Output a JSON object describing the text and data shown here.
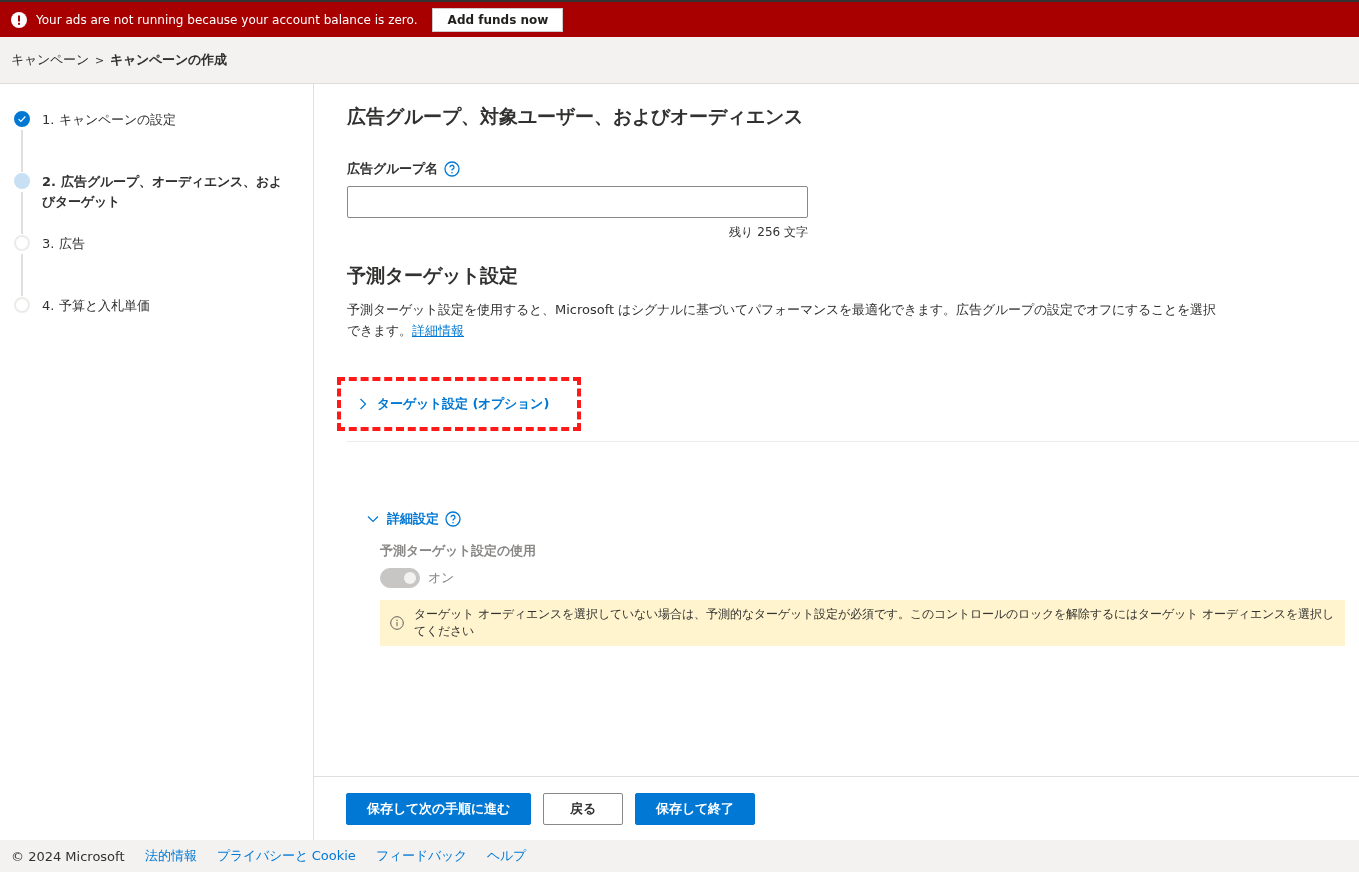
{
  "alert_banner": {
    "message": "Your ads are not running because your account balance is zero.",
    "action": "Add funds now"
  },
  "breadcrumb": [
    {
      "label": "キャンペーン",
      "current": false
    },
    {
      "label": "キャンペーンの作成",
      "current": true
    }
  ],
  "breadcrumb_separator": ">",
  "steps": [
    {
      "label": "1. キャンペーンの設定",
      "completed": true,
      "selected": false
    },
    {
      "label": "2. 広告グループ、オーディエンス、およびターゲット",
      "completed": false,
      "selected": true
    },
    {
      "label": "3. 広告",
      "completed": false,
      "selected": false
    },
    {
      "label": "4. 予算と入札単価",
      "completed": false,
      "selected": false
    }
  ],
  "page_title": "広告グループ、対象ユーザー、およびオーディエンス",
  "ad_group_name": {
    "label": "広告グループ名",
    "remaining": "残り 256 文字"
  },
  "predictive_section": {
    "title": "予測ターゲット設定",
    "description": "予測ターゲット設定を使用すると、Microsoft はシグナルに基づいてパフォーマンスを最適化できます。広告グループの設定でオフにすることを選択できます。",
    "link": "詳細情報"
  },
  "targeting_expander": {
    "label": "ターゲット設定 (オプション)",
    "expanded": false,
    "highlighted": true
  },
  "advanced_expander": {
    "label": "詳細設定",
    "expanded": true
  },
  "predictive_toggle": {
    "label": "予測ターゲット設定の使用",
    "state_text": "オン",
    "on": true,
    "disabled": true
  },
  "info_message": "ターゲット オーディエンスを選択していない場合は、予測的なターゲット設定が必須です。このコントロールのロックを解除するにはターゲット オーディエンスを選択してください",
  "actions": [
    {
      "label": "保存して次の手順に進む",
      "kind": "primary"
    },
    {
      "label": "戻る",
      "kind": "secondary"
    },
    {
      "label": "保存して終了",
      "kind": "primary"
    }
  ],
  "footer": {
    "copyright": "© 2024 Microsoft",
    "links": [
      "法的情報",
      "プライバシーと Cookie",
      "フィードバック",
      "ヘルプ"
    ]
  }
}
